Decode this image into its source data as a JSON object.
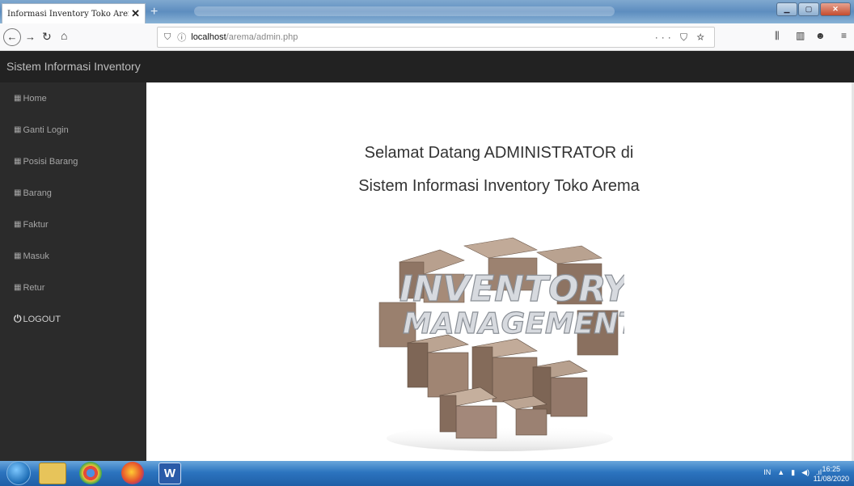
{
  "browser": {
    "tab_title": "Informasi Inventory Toko Arema.",
    "tab_close": "✕",
    "new_tab": "+",
    "url_host": "localhost",
    "url_path": "/arema/admin.php",
    "url_actions": "··· ⛉ ☆"
  },
  "app": {
    "brand": "Sistem Informasi Inventory",
    "sidebar": [
      {
        "icon": "▦",
        "label": "Home"
      },
      {
        "icon": "▦",
        "label": "Ganti Login"
      },
      {
        "icon": "▦",
        "label": "Posisi Barang"
      },
      {
        "icon": "▦",
        "label": "Barang"
      },
      {
        "icon": "▦",
        "label": "Faktur"
      },
      {
        "icon": "▦",
        "label": "Masuk"
      },
      {
        "icon": "▦",
        "label": "Retur"
      }
    ],
    "logout": {
      "icon": "⏻",
      "label": "LOGOUT"
    },
    "welcome_line1": "Selamat Datang ADMINISTRATOR di",
    "welcome_line2": "Sistem Informasi Inventory Toko Arema",
    "image_text_1": "INVENTORY",
    "image_text_2": "MANAGEMENT"
  },
  "taskbar": {
    "lang": "IN",
    "time": "16:25",
    "date": "11/08/2020"
  },
  "colors": {
    "header": "#222222",
    "sidebar": "#2b2b2b",
    "box": "#9c8270"
  }
}
